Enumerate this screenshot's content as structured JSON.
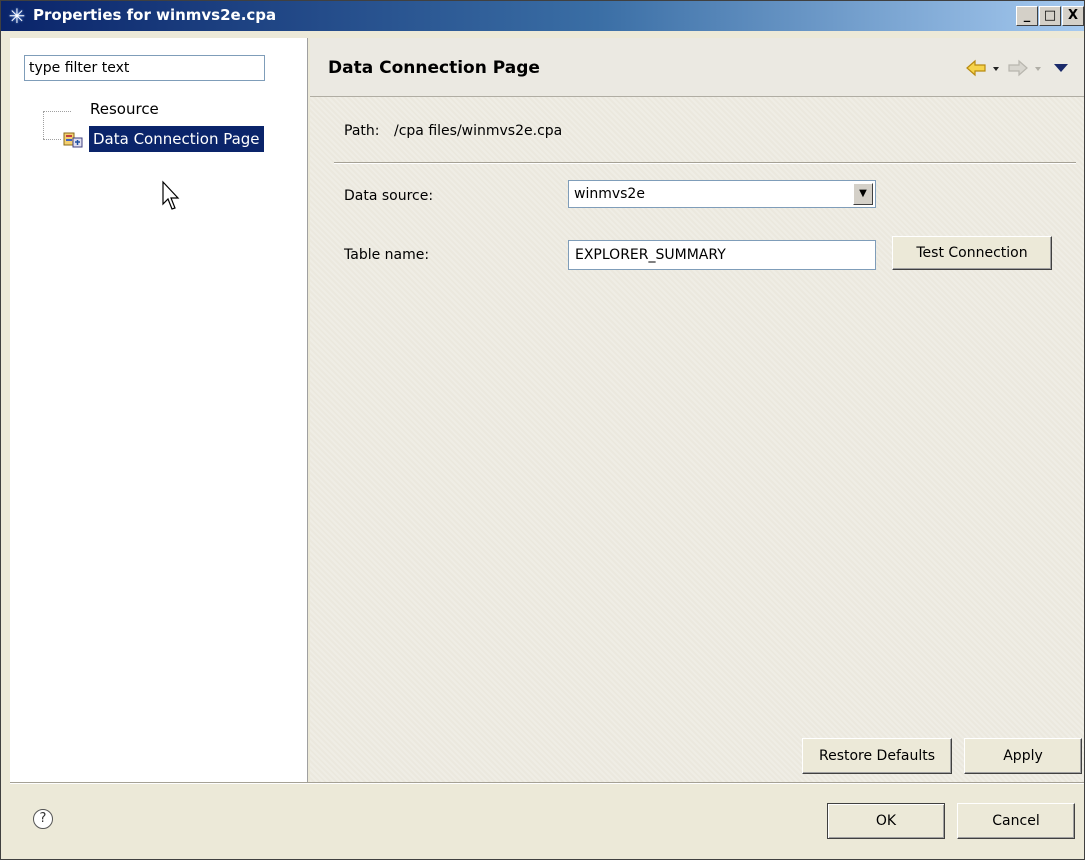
{
  "window": {
    "title": "Properties for winmvs2e.cpa",
    "minimize_label": "_",
    "maximize_label": "□",
    "close_label": "X"
  },
  "filter": {
    "placeholder": "type filter text",
    "value": "type filter text"
  },
  "tree": {
    "items": [
      {
        "label": "Resource",
        "selected": false
      },
      {
        "label": "Data Connection Page",
        "selected": true
      }
    ]
  },
  "page": {
    "title": "Data Connection Page",
    "path_label": "Path:",
    "path_value": "/cpa files/winmvs2e.cpa",
    "data_source_label": "Data source:",
    "data_source_value": "winmvs2e",
    "table_name_label": "Table name:",
    "table_name_value": "EXPLORER_SUMMARY",
    "test_connection_label": "Test Connection",
    "restore_defaults_label": "Restore Defaults",
    "apply_label": "Apply"
  },
  "nav_icons": [
    "back-arrow-icon",
    "forward-arrow-icon",
    "menu-triangle-icon"
  ],
  "footer": {
    "ok_label": "OK",
    "cancel_label": "Cancel",
    "help_icon": "?"
  },
  "colors": {
    "selection": "#0a246a",
    "titlebar_start": "#0a246a",
    "back_arrow": "#f0c020"
  }
}
